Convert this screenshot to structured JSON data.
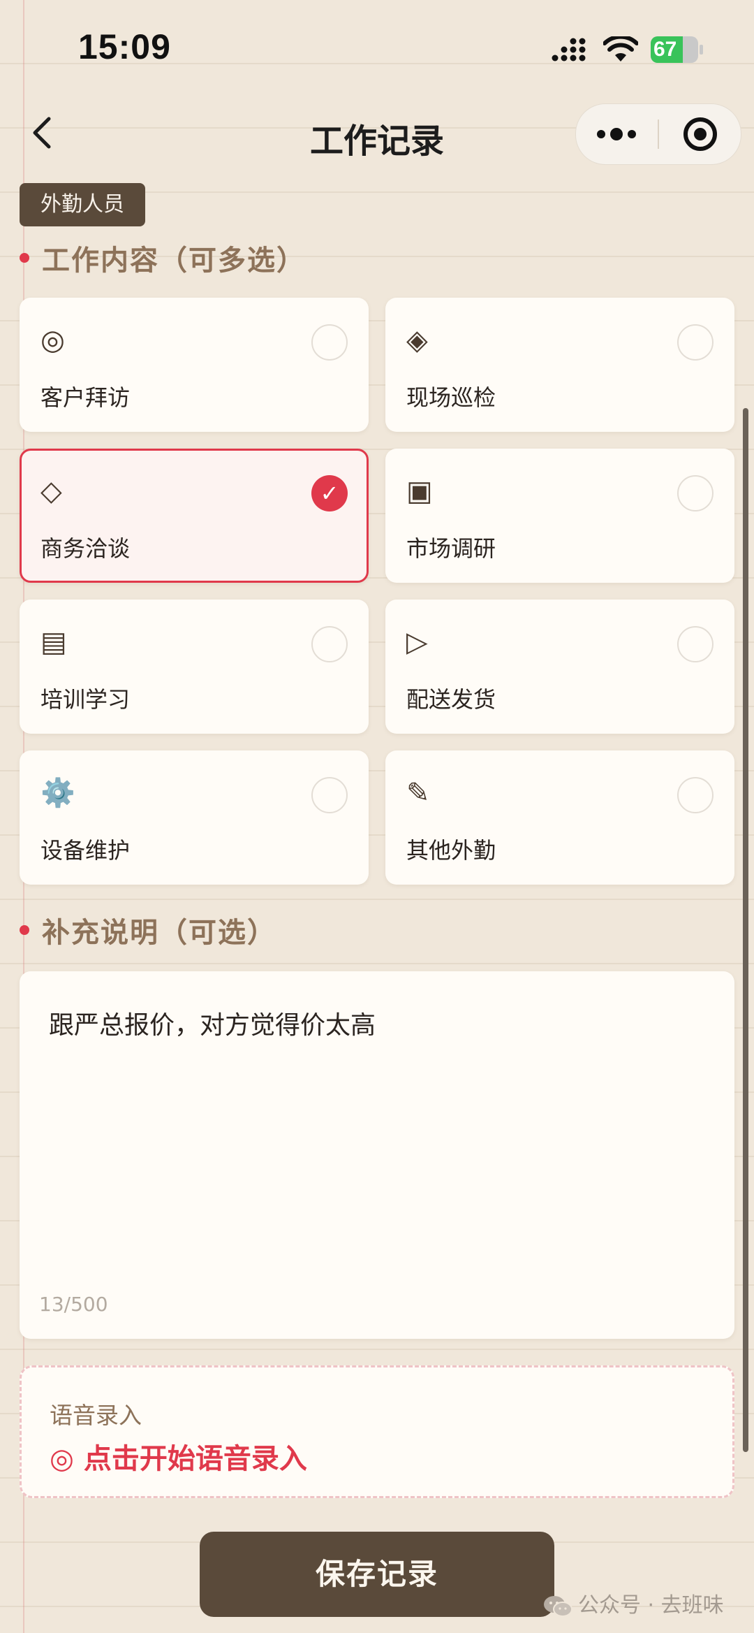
{
  "status_bar": {
    "time": "15:09",
    "battery_level": 67,
    "battery_text": "67"
  },
  "nav": {
    "title": "工作记录",
    "back_icon": "chevron-left-icon",
    "more_icon": "more-dots-icon",
    "close_icon": "target-close-icon"
  },
  "role_badge": "外勤人员",
  "work_section": {
    "title": "工作内容（可多选）",
    "options": [
      {
        "label": "客户拜访",
        "icon": "◎",
        "icon_name": "visit-icon",
        "selected": false
      },
      {
        "label": "现场巡检",
        "icon": "◈",
        "icon_name": "inspection-icon",
        "selected": false
      },
      {
        "label": "商务洽谈",
        "icon": "◇",
        "icon_name": "negotiation-icon",
        "selected": true
      },
      {
        "label": "市场调研",
        "icon": "▣",
        "icon_name": "research-icon",
        "selected": false
      },
      {
        "label": "培训学习",
        "icon": "▤",
        "icon_name": "training-icon",
        "selected": false
      },
      {
        "label": "配送发货",
        "icon": "▷",
        "icon_name": "delivery-icon",
        "selected": false
      },
      {
        "label": "设备维护",
        "icon": "⚙️",
        "icon_name": "gear-icon",
        "selected": false
      },
      {
        "label": "其他外勤",
        "icon": "✎",
        "icon_name": "pencil-icon",
        "selected": false
      }
    ],
    "check_glyph": "✓"
  },
  "notes_section": {
    "title": "补充说明（可选）",
    "text": "跟严总报价，对方觉得价太高",
    "count": "13/500"
  },
  "voice": {
    "label": "语音录入",
    "action": "◎ 点击开始语音录入"
  },
  "save_label": "保存记录",
  "watermark": "公众号 · 去班味",
  "colors": {
    "accent": "#e0394b",
    "primary_dark": "#5a4a3a",
    "heading": "#8d7259",
    "background": "#f0e7da",
    "card": "#fffcf7",
    "battery": "#39c35a"
  }
}
